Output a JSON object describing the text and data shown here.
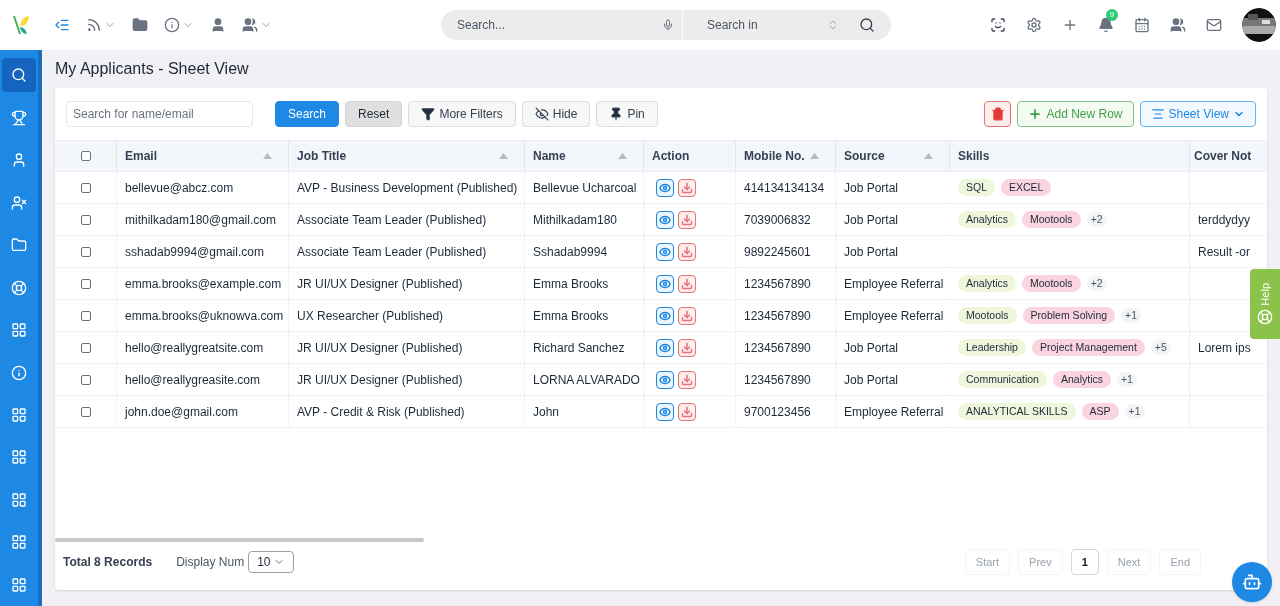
{
  "topbar": {
    "search": {
      "placeholder": "Search...",
      "scope": "Search in"
    },
    "notifications_badge": "9"
  },
  "sidebar": {
    "items": [
      {
        "selected": true
      },
      {
        "selected": false
      },
      {
        "selected": false
      },
      {
        "selected": false
      },
      {
        "selected": false
      },
      {
        "selected": false
      },
      {
        "selected": false
      },
      {
        "selected": false
      },
      {
        "selected": false
      },
      {
        "selected": false
      },
      {
        "selected": false
      },
      {
        "selected": false
      },
      {
        "selected": false
      }
    ]
  },
  "page_title": "My Applicants - Sheet View",
  "toolbar": {
    "search_placeholder": "Search for name/email",
    "buttons": [
      {
        "kind": "search",
        "label": "Search"
      },
      {
        "kind": "reset",
        "label": "Reset"
      },
      {
        "kind": "filter",
        "label": "More Filters"
      },
      {
        "kind": "hide",
        "label": "Hide"
      },
      {
        "kind": "pin",
        "label": "Pin"
      }
    ],
    "right_buttons": [
      {
        "kind": "delete"
      },
      {
        "kind": "add",
        "label": "Add New Row"
      },
      {
        "kind": "view",
        "label": "Sheet View"
      }
    ]
  },
  "table": {
    "select_all": {
      "checked": false
    },
    "columns": [
      {
        "label": "Email",
        "sortable": true
      },
      {
        "label": "Job Title",
        "sortable": true
      },
      {
        "label": "Name",
        "sortable": true
      },
      {
        "label": "Action",
        "sortable": false
      },
      {
        "label": "Mobile No.",
        "sortable": true
      },
      {
        "label": "Source",
        "sortable": true
      },
      {
        "label": "Skills",
        "sortable": false
      },
      {
        "label": "Cover Not",
        "sortable": false
      }
    ],
    "rows": [
      {
        "checked": false,
        "email": "bellevue@abcz.com",
        "job_title": "AVP - Business Development (Published)",
        "name": "Bellevue Ucharcoal",
        "mobile": "414134134134",
        "source": "Job Portal",
        "skills": [
          "SQL",
          "EXCEL"
        ],
        "more": "",
        "cover_note": ""
      },
      {
        "checked": false,
        "email": "mithilkadam180@gmail.com",
        "job_title": "Associate Team Leader (Published)",
        "name": "Mithilkadam180",
        "mobile": "7039006832",
        "source": "Job Portal",
        "skills": [
          "Analytics",
          "Mootools"
        ],
        "more": "+2",
        "cover_note": "terddydyy"
      },
      {
        "checked": false,
        "email": "sshadab9994@gmail.com",
        "job_title": "Associate Team Leader (Published)",
        "name": "Sshadab9994",
        "mobile": "9892245601",
        "source": "Job Portal",
        "skills": [],
        "more": "",
        "cover_note": "Result -or"
      },
      {
        "checked": false,
        "email": "emma.brooks@example.com",
        "job_title": "JR UI/UX Designer (Published)",
        "name": "Emma Brooks",
        "mobile": "1234567890",
        "source": "Employee Referral",
        "skills": [
          "Analytics",
          "Mootools"
        ],
        "more": "+2",
        "cover_note": ""
      },
      {
        "checked": false,
        "email": "emma.brooks@uknowva.com",
        "job_title": "UX Researcher (Published)",
        "name": "Emma Brooks",
        "mobile": "1234567890",
        "source": "Employee Referral",
        "skills": [
          "Mootools",
          "Problem Solving"
        ],
        "more": "+1",
        "cover_note": ""
      },
      {
        "checked": false,
        "email": "hello@reallygreatsite.com",
        "job_title": "JR UI/UX Designer (Published)",
        "name": "Richard Sanchez",
        "mobile": "1234567890",
        "source": "Job Portal",
        "skills": [
          "Leadership",
          "Project Management"
        ],
        "more": "+5",
        "cover_note": "Lorem ips"
      },
      {
        "checked": false,
        "email": "hello@reallygreasite.com",
        "job_title": "JR UI/UX Designer (Published)",
        "name": "LORNA ALVARADO",
        "mobile": "1234567890",
        "source": "Job Portal",
        "skills": [
          "Communication",
          "Analytics"
        ],
        "more": "+1",
        "cover_note": ""
      },
      {
        "checked": false,
        "email": "john.doe@gmail.com",
        "job_title": "AVP - Credit & Risk (Published)",
        "name": "John",
        "mobile": "9700123456",
        "source": "Employee Referral",
        "skills": [
          "ANALYTICAL SKILLS",
          "ASP"
        ],
        "more": "+1",
        "cover_note": ""
      }
    ]
  },
  "footer": {
    "total": "Total 8 Records",
    "display_label": "Display Num",
    "display_value": "10",
    "pages": [
      {
        "label": "Start",
        "selected": false
      },
      {
        "label": "Prev",
        "selected": false
      },
      {
        "label": "1",
        "selected": true
      },
      {
        "label": "Next",
        "selected": false
      },
      {
        "label": "End",
        "selected": false
      }
    ]
  },
  "help_tab": "Help"
}
